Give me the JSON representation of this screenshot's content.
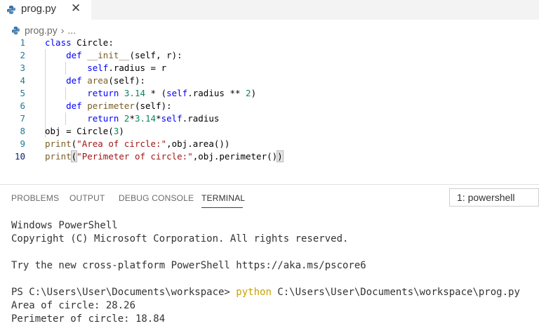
{
  "tab": {
    "filename": "prog.py",
    "close_glyph": "✕"
  },
  "breadcrumb": {
    "file": "prog.py",
    "separator": "›",
    "ellipsis": "..."
  },
  "editor": {
    "line_numbers": [
      "1",
      "2",
      "3",
      "4",
      "5",
      "6",
      "7",
      "8",
      "9",
      "10"
    ],
    "active_line": 10
  },
  "panel": {
    "tabs": [
      "PROBLEMS",
      "OUTPUT",
      "DEBUG CONSOLE",
      "TERMINAL"
    ],
    "active_tab": "TERMINAL",
    "shell_select": "1: powershell"
  },
  "terminal": {
    "line1": "Windows PowerShell",
    "line2": "Copyright (C) Microsoft Corporation. All rights reserved.",
    "line3": "Try the new cross-platform PowerShell https://aka.ms/pscore6",
    "prompt": "PS C:\\Users\\User\\Documents\\workspace> ",
    "command": "python",
    "argument": " C:\\Users\\User\\Documents\\workspace\\prog.py",
    "output1": "Area of circle: 28.26",
    "output2": "Perimeter of circle: 18.84"
  },
  "colors": {
    "keyword": "#0000ff",
    "function": "#795e26",
    "number": "#09885a",
    "string": "#a31515",
    "line_number": "#237893",
    "python_icon": "#3572a5"
  }
}
